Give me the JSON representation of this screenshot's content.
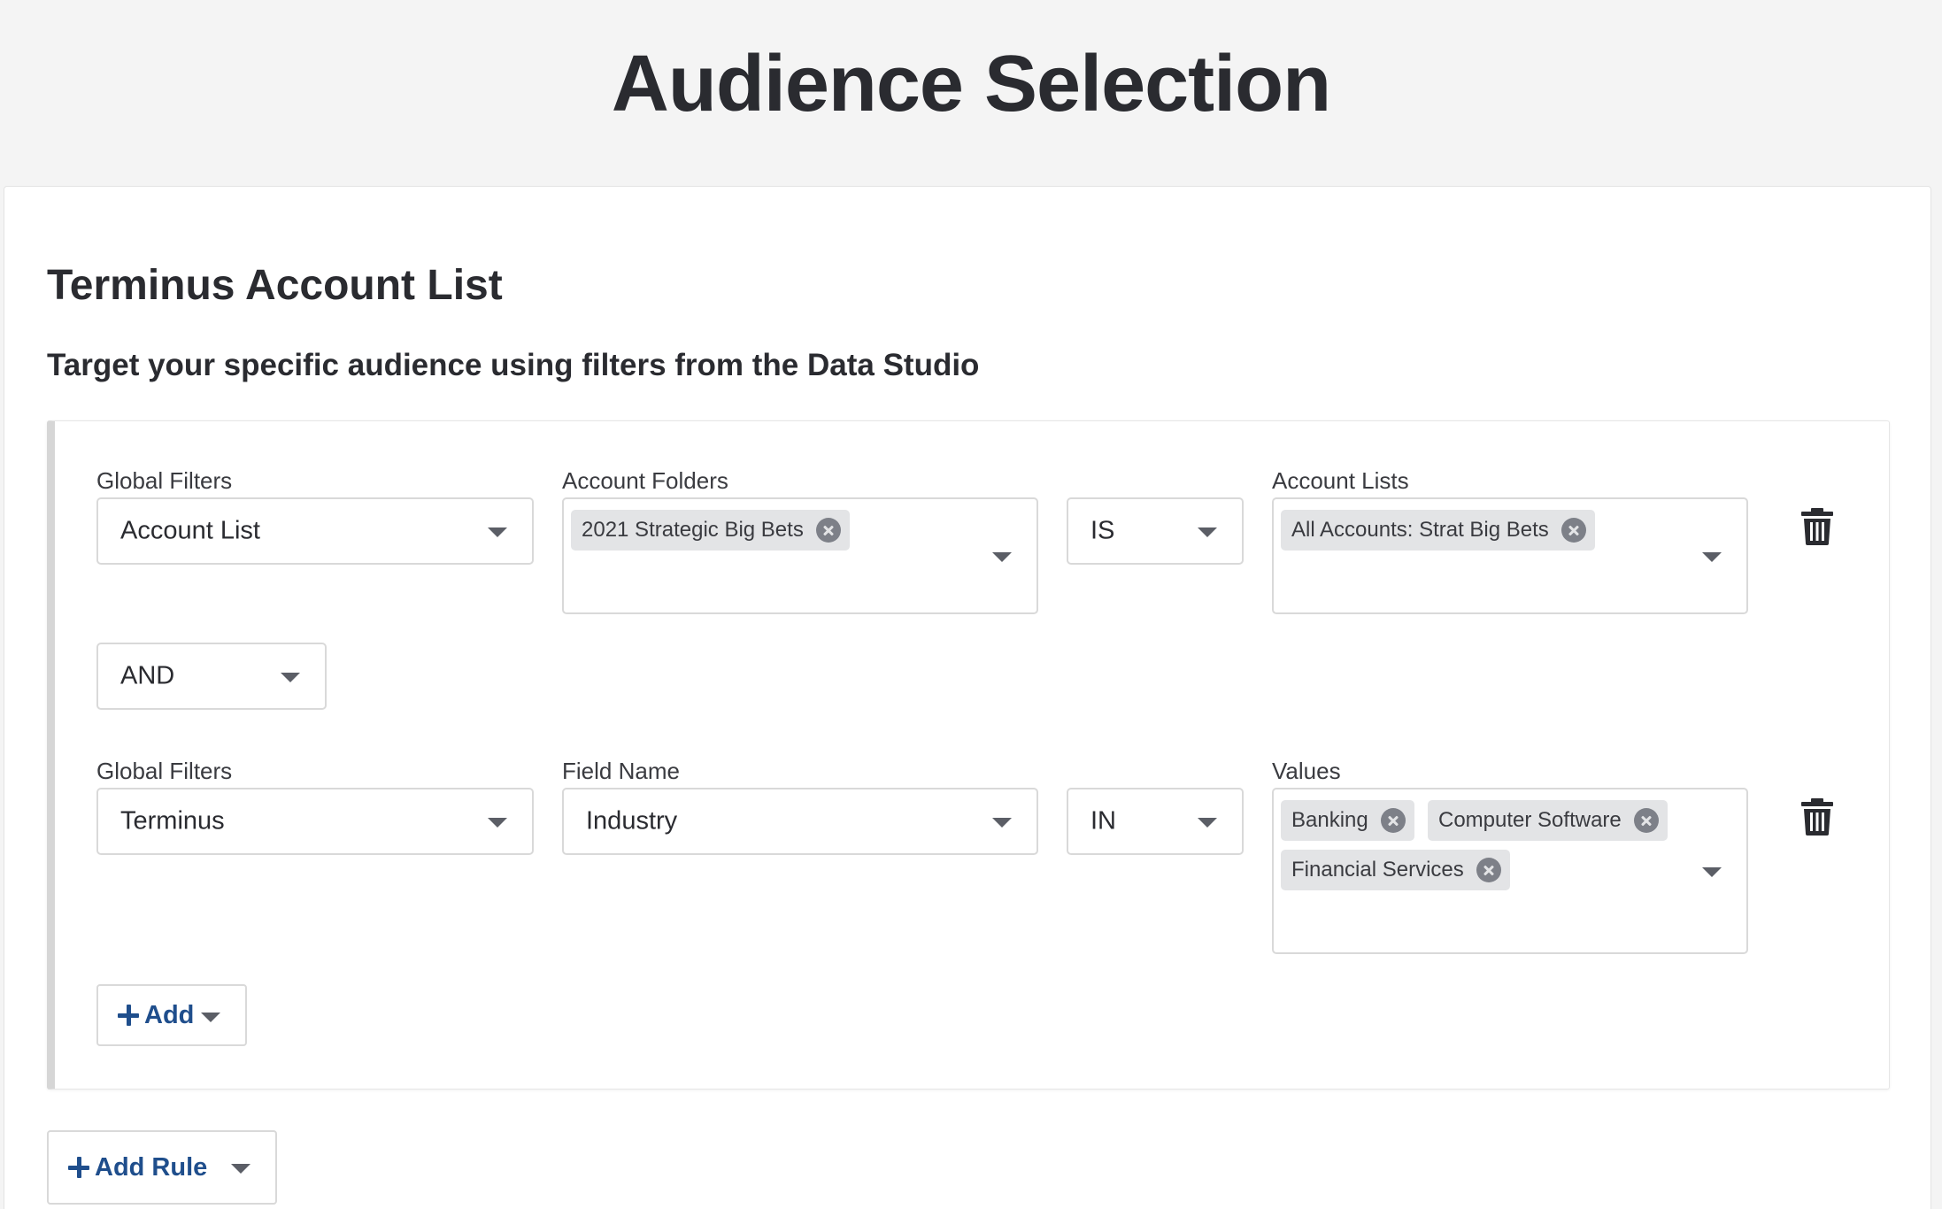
{
  "page": {
    "title": "Audience Selection"
  },
  "section": {
    "title": "Terminus Account List",
    "subtitle": "Target your specific audience using filters from the Data Studio"
  },
  "rule1": {
    "global_filters_label": "Global Filters",
    "global_filters_value": "Account List",
    "folders_label": "Account Folders",
    "folders_chips": [
      "2021 Strategic Big Bets"
    ],
    "operator_value": "IS",
    "lists_label": "Account Lists",
    "lists_chips": [
      "All Accounts: Strat Big Bets"
    ],
    "delete_icon": "trash-icon"
  },
  "connector": {
    "value": "AND"
  },
  "rule2": {
    "global_filters_label": "Global Filters",
    "global_filters_value": "Terminus",
    "field_label": "Field Name",
    "field_value": "Industry",
    "operator_value": "IN",
    "values_label": "Values",
    "values_chips": [
      "Banking",
      "Computer Software",
      "Financial Services"
    ],
    "delete_icon": "trash-icon"
  },
  "buttons": {
    "add_label": "Add",
    "add_rule_label": "Add Rule"
  },
  "colors": {
    "accent": "#1f4e8c",
    "chip_bg": "#e3e4e6",
    "page_bg": "#f4f4f4"
  }
}
